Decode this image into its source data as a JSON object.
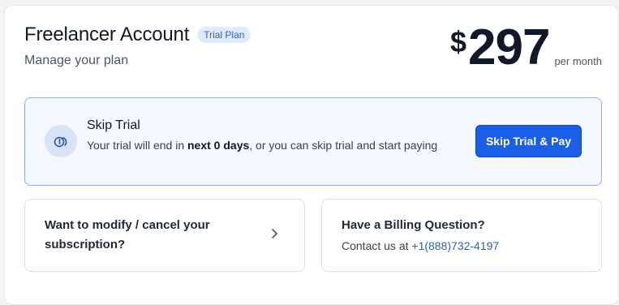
{
  "account": {
    "title": "Freelancer Account",
    "badge": "Trial Plan",
    "subtitle": "Manage your plan"
  },
  "price": {
    "currency": "$",
    "amount": "297",
    "period": "per month"
  },
  "trial": {
    "icon": "coin-icon",
    "title": "Skip Trial",
    "desc_prefix": "Your trial will end in ",
    "desc_bold": "next 0 days",
    "desc_suffix": ", or you can skip trial and start paying",
    "button_label": "Skip Trial & Pay"
  },
  "modify": {
    "label": "Want to modify / cancel your subscription?",
    "icon": "chevron-right-icon"
  },
  "billing": {
    "title": "Have a Billing Question?",
    "contact_prefix": "Contact us at ",
    "phone": "+1(888)732-4197"
  },
  "colors": {
    "accent": "#1a5fe6",
    "badge_bg": "#e0ebff",
    "link": "#2563c9"
  }
}
